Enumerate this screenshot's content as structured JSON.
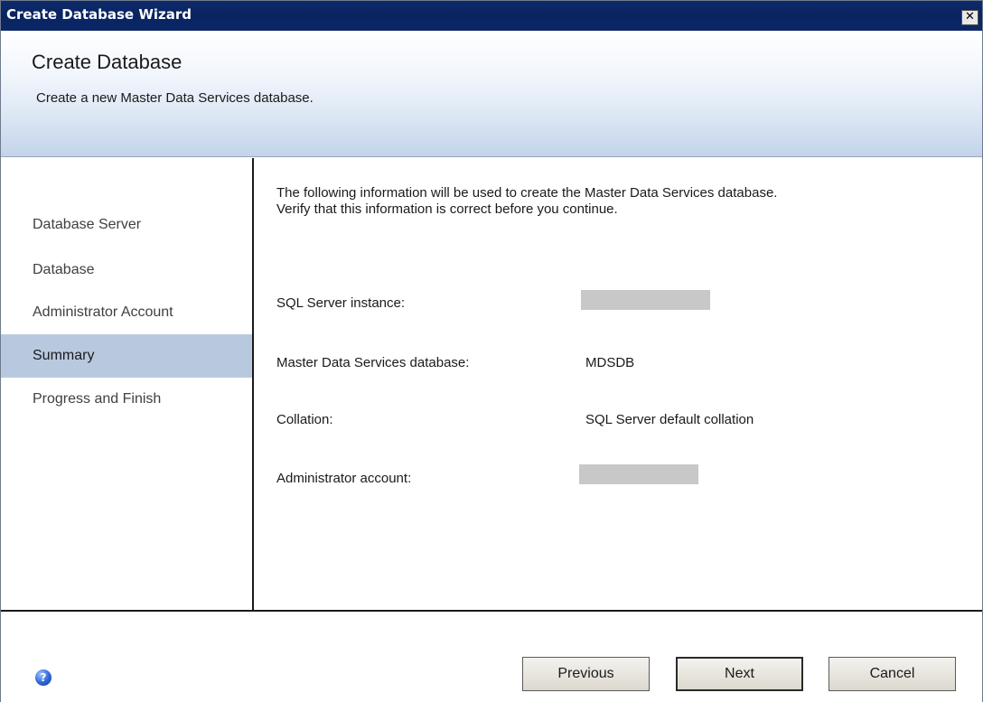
{
  "window": {
    "title": "Create Database Wizard",
    "close_glyph": "✕"
  },
  "header": {
    "title": "Create Database",
    "subtitle": "Create a new Master Data Services database."
  },
  "nav": {
    "items": [
      {
        "label": "Database Server",
        "active": false
      },
      {
        "label": "Database",
        "active": false
      },
      {
        "label": "Administrator Account",
        "active": false
      },
      {
        "label": "Summary",
        "active": true
      },
      {
        "label": "Progress and Finish",
        "active": false
      }
    ]
  },
  "main": {
    "intro_line1": "The following information will be used to create the Master Data Services database.",
    "intro_line2": "Verify that this information is correct before you continue.",
    "fields": [
      {
        "label": "SQL Server instance:",
        "value": ""
      },
      {
        "label": "Master Data Services database:",
        "value": "MDSDB"
      },
      {
        "label": "Collation:",
        "value": "SQL Server default collation"
      },
      {
        "label": "Administrator account:",
        "value": ""
      }
    ]
  },
  "footer": {
    "help_glyph": "?",
    "previous_label": "Previous",
    "next_label": "Next",
    "cancel_label": "Cancel"
  },
  "colors": {
    "titlebar": "#0a2462",
    "nav_active": "#b8c9df",
    "redaction": "#c8c8c8"
  }
}
